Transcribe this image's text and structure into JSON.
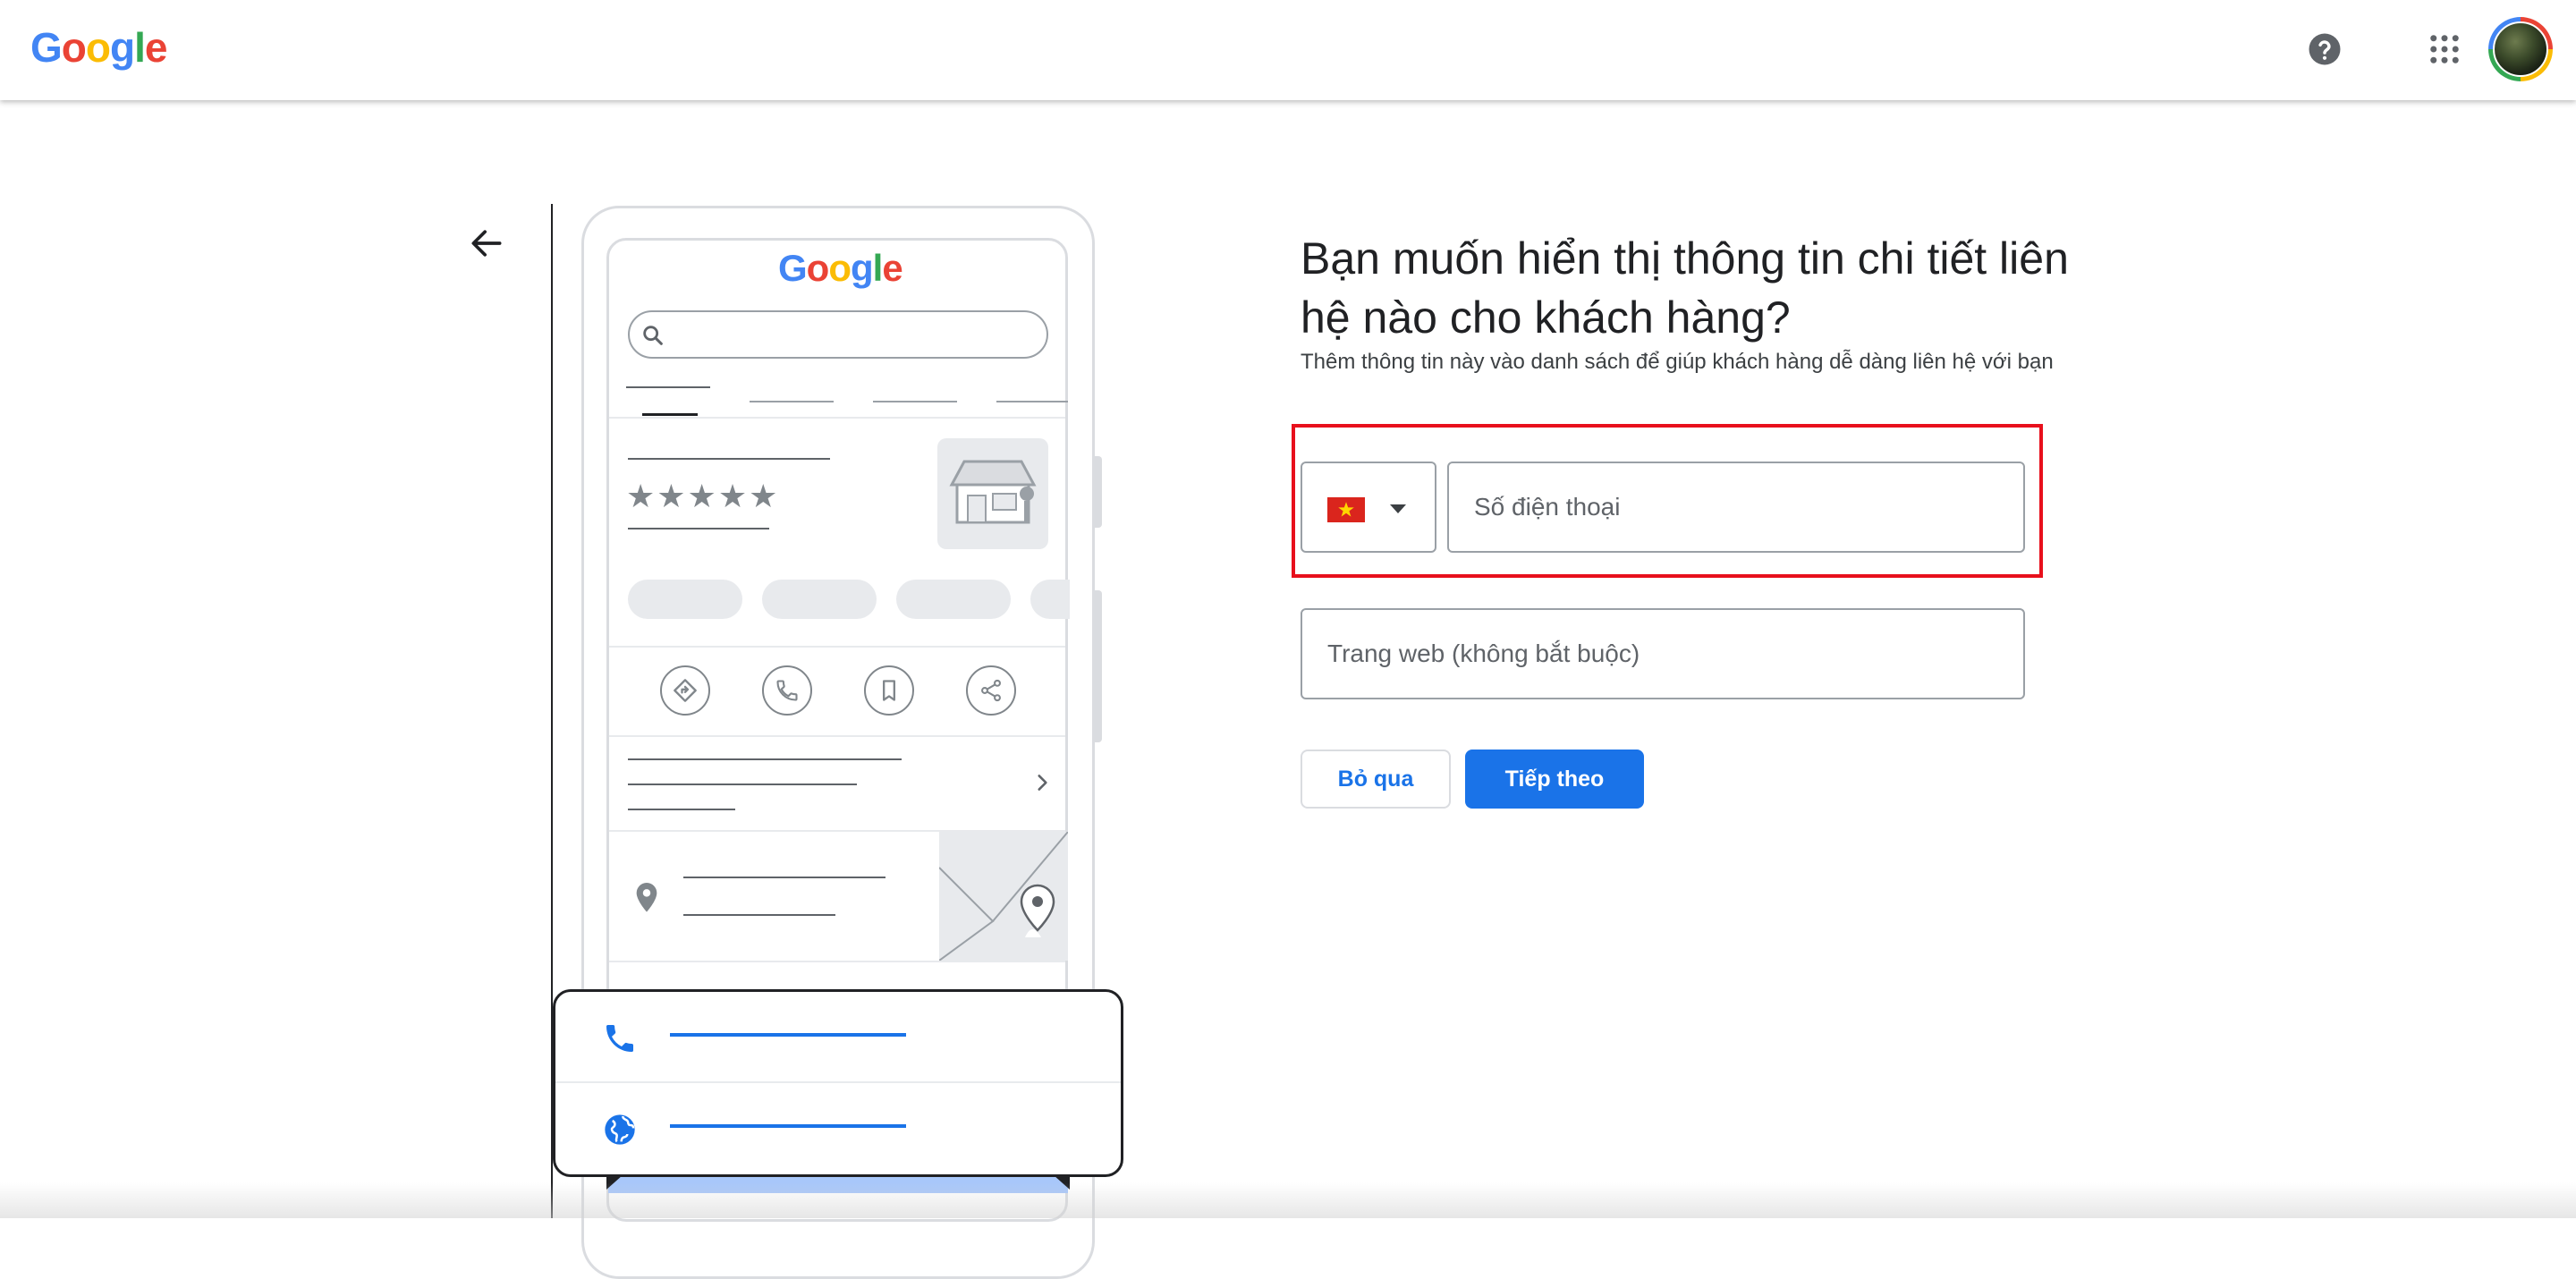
{
  "header": {
    "logo_letters": [
      {
        "char": "G",
        "color": "#4285f4"
      },
      {
        "char": "o",
        "color": "#ea4335"
      },
      {
        "char": "o",
        "color": "#fbbc05"
      },
      {
        "char": "g",
        "color": "#4285f4"
      },
      {
        "char": "l",
        "color": "#34a853"
      },
      {
        "char": "e",
        "color": "#ea4335"
      }
    ],
    "icons": [
      "help-icon",
      "apps-grid-icon",
      "account-avatar"
    ]
  },
  "illustration": {
    "logo_letters": [
      {
        "char": "G",
        "color": "#4285f4"
      },
      {
        "char": "o",
        "color": "#ea4335"
      },
      {
        "char": "o",
        "color": "#fbbc05"
      },
      {
        "char": "g",
        "color": "#4285f4"
      },
      {
        "char": "l",
        "color": "#34a853"
      },
      {
        "char": "e",
        "color": "#ea4335"
      }
    ],
    "stars": "★★★★★",
    "action_icons": [
      "directions-icon",
      "call-icon",
      "bookmark-icon",
      "share-icon"
    ],
    "card_icons": [
      "phone-icon",
      "globe-icon"
    ]
  },
  "form": {
    "title": "Bạn muốn hiển thị thông tin chi tiết liên hệ nào cho khách hàng?",
    "subtitle": "Thêm thông tin này vào danh sách để giúp khách hàng dễ dàng liên hệ với bạn",
    "country_flag": "vietnam-flag-icon",
    "phone_placeholder": "Số điện thoại",
    "website_placeholder": "Trang web (không bắt buộc)",
    "skip_label": "Bỏ qua",
    "next_label": "Tiếp theo"
  },
  "colors": {
    "accent": "#1a73e8",
    "highlight": "#e8101c"
  }
}
